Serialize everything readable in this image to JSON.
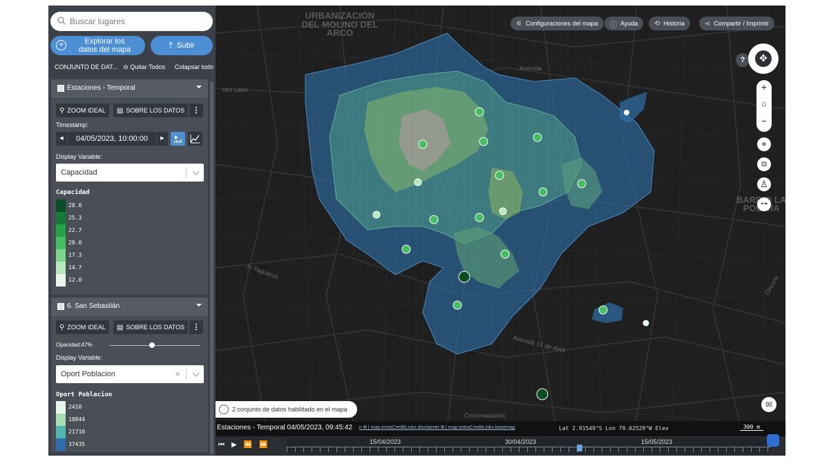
{
  "search": {
    "placeholder": "Buscar lugares"
  },
  "actions": {
    "explore_label": "Explorar los datos del mapa",
    "upload_label": "Subir"
  },
  "datasets_header": {
    "title": "CONJUNTO DE DAT...",
    "remove_all": "Quitar Todos",
    "collapse_all": "Colapsar todo"
  },
  "panel1": {
    "title": "Estaciones - Temporal",
    "zoom_label": "ZOOM IDEAL",
    "about_label": "SOBRE LOS DATOS",
    "timestamp_label": "Timestamp:",
    "timestamp_value": "04/05/2023, 10:00:00",
    "display_variable_label": "Display Variable:",
    "display_variable_value": "Capacidad",
    "legend_title": "Capacidad",
    "legend": [
      {
        "label": "28.0",
        "color": "#0b4d24"
      },
      {
        "label": "25.3",
        "color": "#157a35"
      },
      {
        "label": "22.7",
        "color": "#22a447"
      },
      {
        "label": "20.0",
        "color": "#46bf61"
      },
      {
        "label": "17.3",
        "color": "#7dd48b"
      },
      {
        "label": "14.7",
        "color": "#b6e8bd"
      },
      {
        "label": "12.0",
        "color": "#eaf8ec"
      }
    ]
  },
  "panel2": {
    "title": "6. San Sebastián",
    "zoom_label": "ZOOM IDEAL",
    "about_label": "SOBRE LOS DATOS",
    "opacity_label": "Opacidad:47%",
    "opacity_value": 0.47,
    "display_variable_label": "Display Variable:",
    "display_variable_value": "Oport Poblacion",
    "legend_title": "Oport Poblacion",
    "legend": [
      {
        "label": "2410",
        "color": "#e8f6ea"
      },
      {
        "label": "10844",
        "color": "#a9dfb3"
      },
      {
        "label": "21710",
        "color": "#4fb7b0"
      },
      {
        "label": "37435",
        "color": "#2f6fb1"
      }
    ]
  },
  "map": {
    "top_buttons": [
      "Configuraciones del mapa",
      "Ayuda",
      "Historia",
      "Compartir / Imprimir"
    ],
    "labels": {
      "urb1": "URBANIZACIÓN",
      "urb2": "DEL MOLINO DEL",
      "urb3": "ARCO",
      "barrio1": "BARRIO LA",
      "barrio2": "POLICÍA",
      "street1": "nez Lazo",
      "street2": "Avenida",
      "street3": "lo Yaguarus",
      "street4": "Avenida 12 de Abril",
      "street5": "Circunvalación",
      "street6": "Circunv"
    },
    "hint": "2 conjunto de datos habilitado en el mapa",
    "bottom_title": "Estaciones - Temporal 04/05/2023, 09:45:42",
    "credits": "n ⧉ | map.extraCreditLinks.disclaimer ⧉ | map.extraCreditLinks.basemap",
    "coords": "Lat  2.91549°S   Lon  79.02529°W   Elev",
    "scale": "300 m",
    "timeline_dates": [
      "15/04/2023",
      "30/04/2023",
      "15/05/2023"
    ],
    "help": "?"
  }
}
